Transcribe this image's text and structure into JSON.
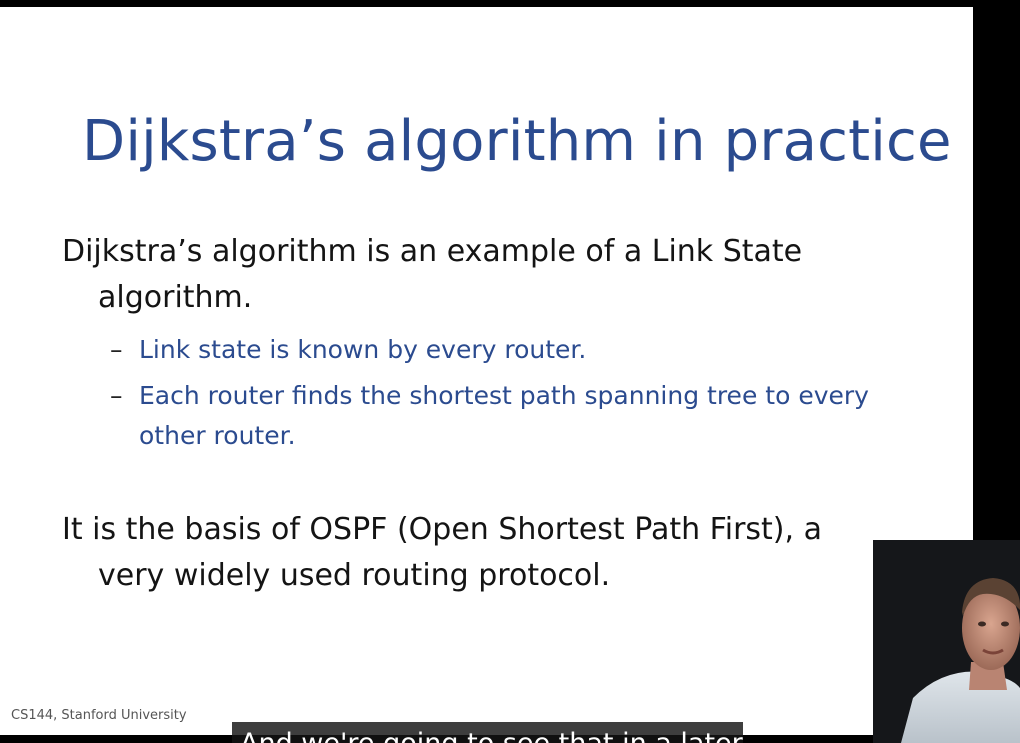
{
  "slide": {
    "title": "Dijkstra’s algorithm in practice",
    "bullets": [
      {
        "text": "Dijkstra’s algorithm is an example of a Link State algorithm.",
        "sub_items": [
          "Link state is known by every router.",
          "Each router finds the shortest path spanning tree to every other router."
        ]
      },
      {
        "text": "It is the basis of OSPF (Open Shortest Path First), a very widely used routing protocol.",
        "sub_items": []
      }
    ],
    "sub_bullet_marker": "–",
    "footer": "CS144, Stanford University"
  },
  "caption": {
    "text": "And we're going to see that in a later"
  },
  "colors": {
    "title": "#2b4b8f",
    "sub_bullet_text": "#2b4b8f",
    "body_text": "#141414",
    "background": "#ffffff",
    "frame": "#000000"
  }
}
